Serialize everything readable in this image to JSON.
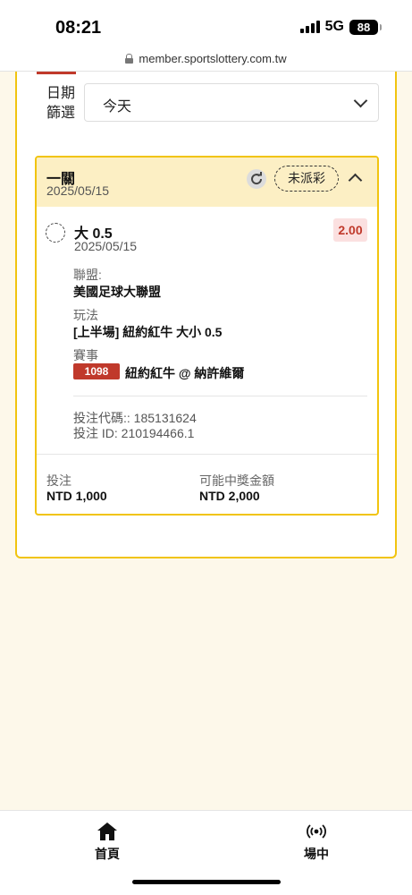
{
  "status_bar": {
    "time": "08:21",
    "network": "5G",
    "battery": "88"
  },
  "browser": {
    "url": "member.sportslottery.com.tw"
  },
  "filter": {
    "label_line1": "日期",
    "label_line2": "篩選",
    "selected": "今天"
  },
  "bet": {
    "title": "一關",
    "date": "2025/05/15",
    "status": "未派彩",
    "selection": {
      "name": "大 0.5",
      "date": "2025/05/15",
      "odds": "2.00",
      "league_label": "聯盟:",
      "league": "美國足球大聯盟",
      "market_label": "玩法",
      "market": "[上半場] 紐約紅牛 大小 0.5",
      "event_label": "賽事",
      "event_code": "1098",
      "event": "紐約紅牛 @ 納許維爾"
    },
    "bet_code": "投注代碼:: 185131624",
    "bet_id": "投注 ID: 210194466.1",
    "stake_label": "投注",
    "stake": "NTD 1,000",
    "potential_win_label": "可能中獎金額",
    "potential_win": "NTD 2,000"
  },
  "bottom_nav": {
    "home_label": "首頁",
    "live_label": "場中"
  },
  "colors": {
    "accent": "#f1c40f",
    "header_bg": "#fcefc4",
    "danger": "#c0392b",
    "page_bg": "#fdf8ea"
  },
  "icons": [
    "lock-icon",
    "chevron-down-icon",
    "refresh-icon",
    "chevron-up-icon",
    "home-icon",
    "live-icon"
  ]
}
